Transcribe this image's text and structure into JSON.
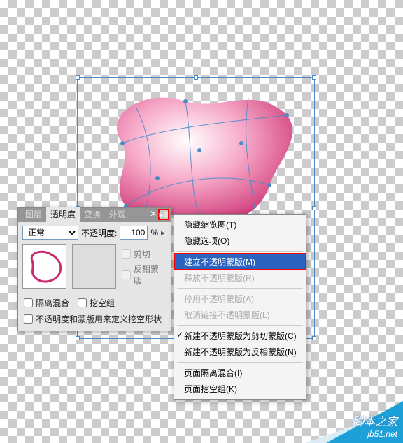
{
  "panel": {
    "tabs": [
      "图层",
      "透明度",
      "变换",
      "外观"
    ],
    "active_tab_index": 1,
    "blend_mode_label": "正常",
    "opacity_label": "不透明度:",
    "opacity_value": "100",
    "opacity_suffix": "%",
    "clip_label": "剪切",
    "invert_label": "反相蒙版",
    "isolate_label": "隔离混合",
    "knockout_label": "挖空组",
    "define_label": "不透明度和蒙版用来定义挖空形状"
  },
  "menu": {
    "items": [
      {
        "label": "隐藏缩览图(T)",
        "enabled": true
      },
      {
        "label": "隐藏选项(O)",
        "enabled": true
      },
      {
        "sep": true
      },
      {
        "label": "建立不透明蒙版(M)",
        "enabled": true,
        "highlight": true
      },
      {
        "label": "释放不透明蒙版(R)",
        "enabled": false
      },
      {
        "sep": true
      },
      {
        "label": "停用不透明蒙版(A)",
        "enabled": false
      },
      {
        "label": "取消链接不透明蒙版(L)",
        "enabled": false
      },
      {
        "sep": true
      },
      {
        "label": "新建不透明蒙版为剪切蒙版(C)",
        "enabled": true,
        "checked": true
      },
      {
        "label": "新建不透明蒙版为反相蒙版(N)",
        "enabled": true
      },
      {
        "sep": true
      },
      {
        "label": "页面隔离混合(I)",
        "enabled": true
      },
      {
        "label": "页面挖空组(K)",
        "enabled": true
      }
    ]
  },
  "watermark": {
    "site": "脚本之家",
    "url": "jb51.net"
  }
}
